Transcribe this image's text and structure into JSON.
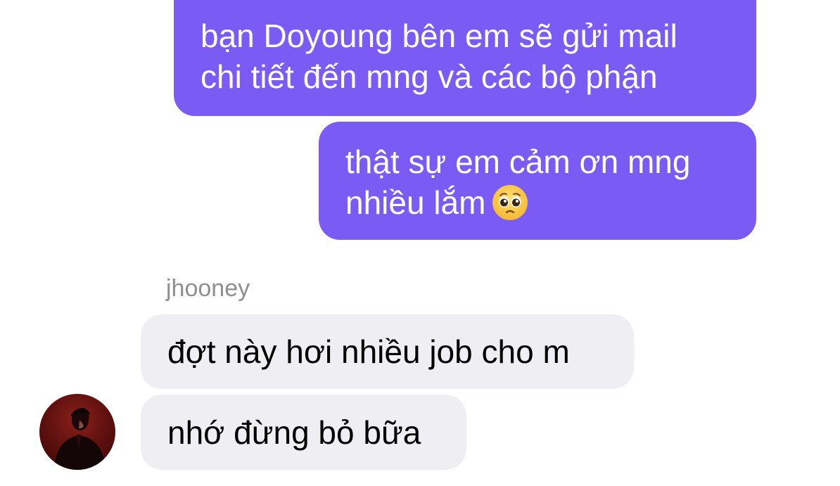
{
  "conversation": {
    "outgoing": [
      {
        "lines": [
          "bạn Doyoung bên em sẽ gửi mail",
          "chi tiết đến mng và các bộ phận"
        ]
      },
      {
        "lines": [
          "thật sự em cảm ơn mng",
          "nhiều lắm"
        ],
        "emoji": "pleading-face"
      }
    ],
    "sender_name": "jhooney",
    "incoming": [
      {
        "text": "đợt này hơi nhiều job cho m"
      },
      {
        "text": "nhớ đừng bỏ bữa"
      }
    ]
  },
  "colors": {
    "outgoing_bubble": "#7a5cf5",
    "incoming_bubble": "#efeff3",
    "sender_name": "#8e8e93"
  }
}
